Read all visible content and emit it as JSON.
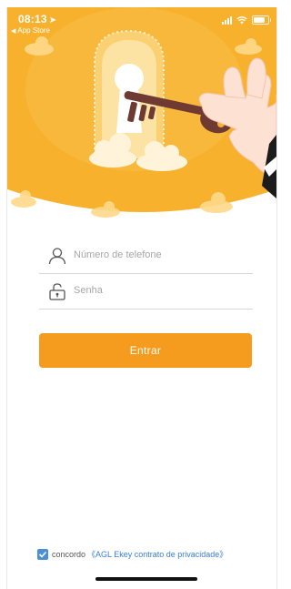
{
  "status_bar": {
    "time": "08:13",
    "location_glyph": "➤",
    "back_app": "App Store",
    "signal_icon": "signal-icon",
    "wifi_icon": "wifi-icon",
    "battery_icon": "battery-icon"
  },
  "hero": {
    "illustration": "key-in-keyhole-illustration",
    "background_color": "#f7b12c"
  },
  "form": {
    "phone_placeholder": "Número de telefone",
    "phone_value": "",
    "password_placeholder": "Senha",
    "password_value": ""
  },
  "login_button": {
    "label": "Entrar",
    "color": "#f59c1e"
  },
  "agreement": {
    "checked": true,
    "prefix": "concordo",
    "link": "《AGL Ekey contrato de privacidade》"
  }
}
